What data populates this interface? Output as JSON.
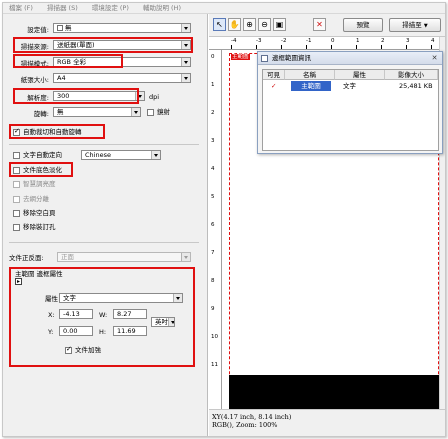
{
  "menu": [
    "檔案 (F)",
    "掃描器 (S)",
    "環境設定 (P)",
    "輔助說明 (H)"
  ],
  "settings": {
    "preset_label": "設定值:",
    "preset_value": "無",
    "scan_source_label": "掃描來源:",
    "scan_source_value": "送紙器(單面)",
    "scan_mode_label": "掃描模式:",
    "scan_mode_value": "RGB 全彩",
    "paper_size_label": "紙張大小:",
    "paper_size_value": "A4",
    "resolution_label": "解析度:",
    "resolution_value": "300",
    "resolution_unit": "dpi",
    "rotate_label": "旋轉:",
    "rotate_value": "無",
    "mirror_label": "鏡射",
    "auto_crop_label": "自動裁切和自動旋轉",
    "auto_ocr_label": "文字自動定向",
    "ocr_language": "Chinese",
    "doc_bg_label": "文件底色淡化",
    "smart_enhance_label": "智慧調亮度",
    "descreen_label": "去網分離",
    "remove_blank_label": "移除空白頁",
    "remove_holes_label": "移除裝訂孔"
  },
  "document": {
    "front_label": "文件正反面:",
    "front_value": "正面"
  },
  "region": {
    "group_title": "主範圍 邊框屬性",
    "attr_label": "屬性",
    "attr_value": "文字",
    "x_label": "X:",
    "x_value": "-4.13",
    "w_label": "W:",
    "w_value": "8.27",
    "y_label": "Y:",
    "y_value": "0.00",
    "h_label": "H:",
    "h_value": "11.69",
    "unit_value": "英吋",
    "enhance_label": "文件加強"
  },
  "toolbar": {
    "preview_label": "預覽",
    "scan_label": "掃描至"
  },
  "ruler": {
    "h_ticks": [
      "-4",
      "-3",
      "-2",
      "-1",
      "0",
      "1",
      "2",
      "3",
      "4"
    ],
    "v_ticks": [
      "0",
      "1",
      "2",
      "3",
      "4",
      "5",
      "6",
      "7",
      "8",
      "9",
      "10",
      "11"
    ],
    "main_tag": "主範圍"
  },
  "dialog": {
    "title": "邊框範圍資訊",
    "columns": [
      "可見",
      "名稱",
      "屬性",
      "影像大小"
    ],
    "row": {
      "name": "主範圍",
      "attr": "文字",
      "size": "25,481 KB"
    }
  },
  "status": {
    "line1": "XY(4.17 inch, 8.14 inch)",
    "line2": "RGB(), Zoom: 100%"
  }
}
